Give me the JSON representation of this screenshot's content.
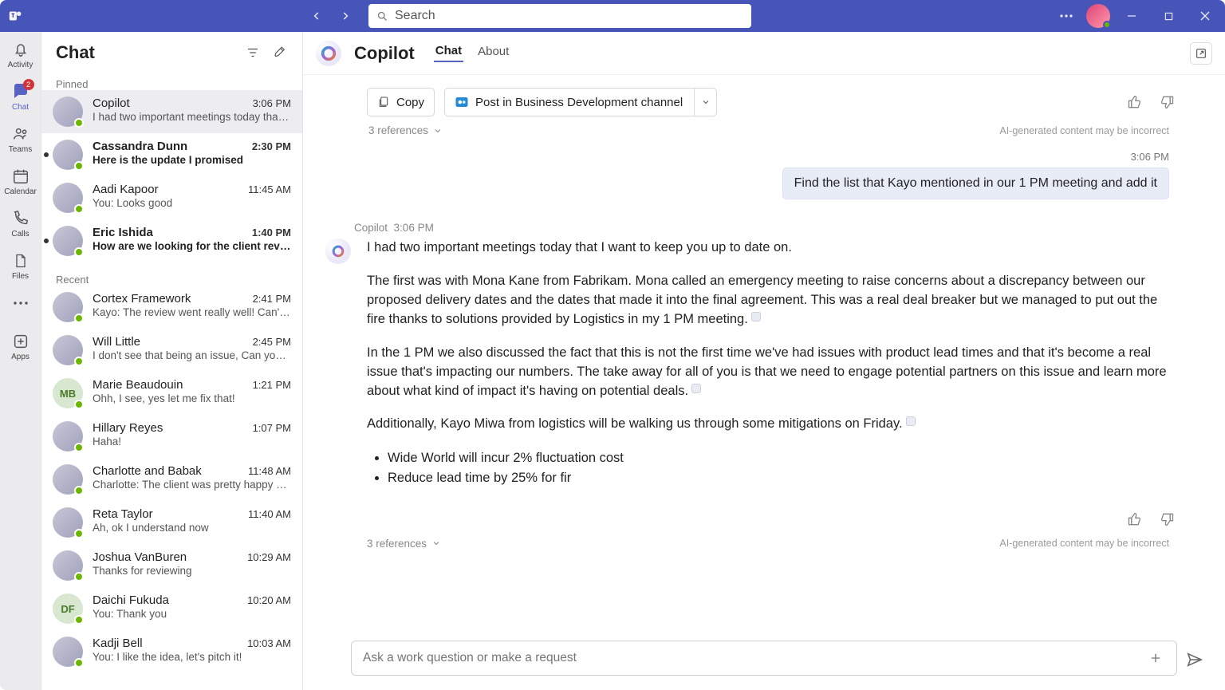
{
  "window": {
    "search_placeholder": "Search"
  },
  "leftrail": {
    "items": [
      {
        "label": "Activity"
      },
      {
        "label": "Chat",
        "badge": "2"
      },
      {
        "label": "Teams"
      },
      {
        "label": "Calendar"
      },
      {
        "label": "Calls"
      },
      {
        "label": "Files"
      },
      {
        "label": ""
      },
      {
        "label": "Apps"
      }
    ]
  },
  "chatpanel": {
    "title": "Chat",
    "pinned_label": "Pinned",
    "recent_label": "Recent",
    "pinned": [
      {
        "name": "Copilot",
        "time": "3:06 PM",
        "preview": "I had two important meetings today that I..."
      },
      {
        "name": "Cassandra Dunn",
        "time": "2:30 PM",
        "preview": "Here is the update I promised",
        "bold": true,
        "unread": true
      },
      {
        "name": "Aadi Kapoor",
        "time": "11:45 AM",
        "preview": "You: Looks good"
      },
      {
        "name": "Eric Ishida",
        "time": "1:40 PM",
        "preview": "How are we looking for the client review?",
        "bold": true,
        "unread": true
      }
    ],
    "recent": [
      {
        "name": "Cortex Framework",
        "time": "2:41 PM",
        "preview": "Kayo: The review went really well! Can't wai..."
      },
      {
        "name": "Will Little",
        "time": "2:45 PM",
        "preview": "I don't see that being an issue, Can you ta..."
      },
      {
        "name": "Marie Beaudouin",
        "initials": "MB",
        "time": "1:21 PM",
        "preview": "Ohh, I see, yes let me fix that!"
      },
      {
        "name": "Hillary Reyes",
        "time": "1:07 PM",
        "preview": "Haha!"
      },
      {
        "name": "Charlotte and Babak",
        "time": "11:48 AM",
        "preview": "Charlotte: The client was pretty happy with..."
      },
      {
        "name": "Reta Taylor",
        "time": "11:40 AM",
        "preview": "Ah, ok I understand now"
      },
      {
        "name": "Joshua VanBuren",
        "time": "10:29 AM",
        "preview": "Thanks for reviewing"
      },
      {
        "name": "Daichi Fukuda",
        "initials": "DF",
        "time": "10:20 AM",
        "preview": "You: Thank you"
      },
      {
        "name": "Kadji Bell",
        "time": "10:03 AM",
        "preview": "You: I like the idea, let's pitch it!"
      }
    ]
  },
  "conversation": {
    "title": "Copilot",
    "tabs": [
      "Chat",
      "About"
    ],
    "actions": {
      "copy": "Copy",
      "post_channel": "Post in Business Development channel",
      "references": "3 references",
      "ai_note": "AI-generated content may be incorrect"
    },
    "user_message": {
      "time": "3:06 PM",
      "text": "Find the list that Kayo mentioned in our 1 PM meeting and add it"
    },
    "copilot_reply": {
      "author": "Copilot",
      "time": "3:06 PM",
      "p1": "I had two important meetings today that I want to keep you up to date on.",
      "p2": "The first was with Mona Kane from Fabrikam. Mona called an emergency meeting to raise concerns about a discrepancy between our proposed delivery dates and the dates that made it into the final agreement. This was a real deal breaker but we managed to put out the fire thanks to solutions provided by Logistics in my 1 PM meeting.",
      "p3": "In the 1 PM we also discussed the fact that this is not the first time we've had issues with product lead times and that it's become a real issue that's impacting our numbers. The take away for all of you is that we need to engage potential partners on this issue and learn more about what kind of impact it's having on potential deals.",
      "p4": "Additionally, Kayo Miwa from logistics will be walking us through some mitigations on Friday.",
      "bullets": [
        "Wide World will incur 2% fluctuation cost",
        "Reduce lead time by 25% for fir"
      ],
      "references": "3 references",
      "ai_note": "AI-generated content may be incorrect"
    },
    "composer_placeholder": "Ask a work question or make a request"
  }
}
